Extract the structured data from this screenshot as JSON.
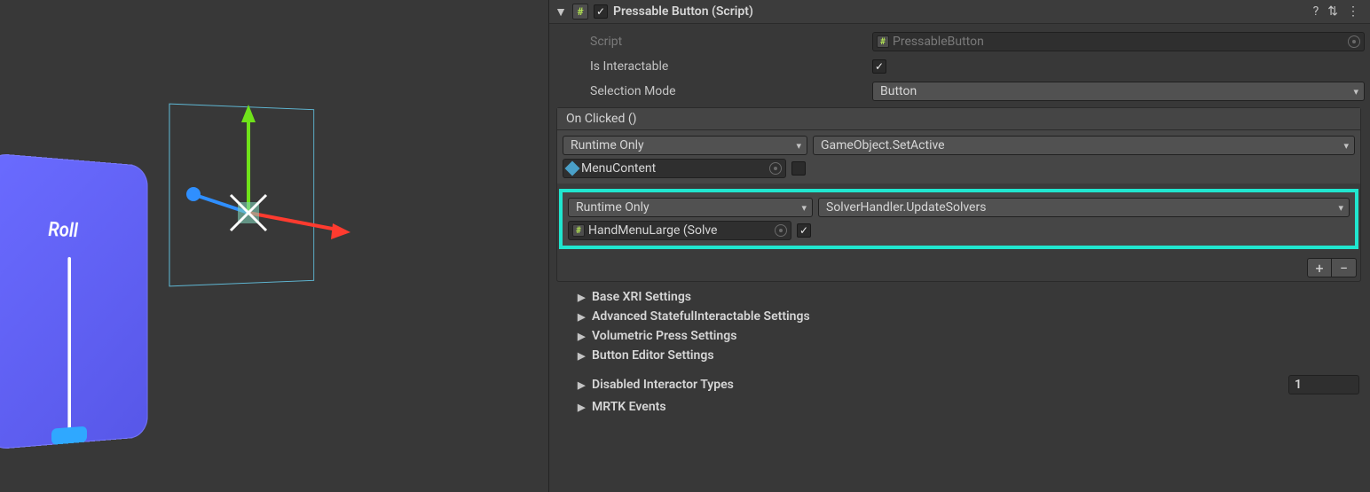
{
  "scene": {
    "label": "Roll"
  },
  "component": {
    "title": "Pressable Button (Script)",
    "enabled": true,
    "fields": {
      "script_label": "Script",
      "script_value": "PressableButton",
      "is_interactable_label": "Is Interactable",
      "is_interactable_value": true,
      "selection_mode_label": "Selection Mode",
      "selection_mode_value": "Button"
    },
    "event": {
      "header": "On Clicked ()",
      "entries": [
        {
          "call_state": "Runtime Only",
          "function": "GameObject.SetActive",
          "target": "MenuContent",
          "arg_checked": false
        },
        {
          "call_state": "Runtime Only",
          "function": "SolverHandler.UpdateSolvers",
          "target": "HandMenuLarge (Solve",
          "arg_checked": true
        }
      ]
    },
    "foldouts": [
      "Base XRI Settings",
      "Advanced StatefulInteractable Settings",
      "Volumetric Press Settings",
      "Button Editor Settings"
    ],
    "disabled_interactor": {
      "label": "Disabled Interactor Types",
      "count": "1"
    },
    "mrtk_events_label": "MRTK Events"
  },
  "icons": {
    "script_glyph": "#",
    "help": "?",
    "preset": "⇅",
    "menu": "⋮",
    "plus": "+",
    "minus": "−",
    "tri_right": "▶",
    "tri_down": "▼"
  }
}
